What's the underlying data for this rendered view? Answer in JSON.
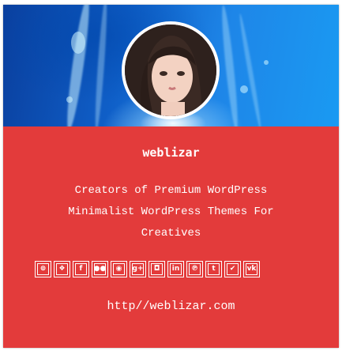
{
  "profile": {
    "name": "weblizar",
    "description_lines": [
      "Creators of Premium WordPress",
      "Minimalist WordPress Themes For",
      "Creatives"
    ],
    "url": "http//weblizar.com"
  },
  "social_icons": [
    {
      "name": "instagram-icon",
      "glyph": "⊚"
    },
    {
      "name": "dropbox-icon",
      "glyph": "❖"
    },
    {
      "name": "facebook-icon",
      "glyph": "f"
    },
    {
      "name": "flickr-icon",
      "glyph": "●●"
    },
    {
      "name": "github-icon",
      "glyph": "◉"
    },
    {
      "name": "google-plus-icon",
      "glyph": "g+"
    },
    {
      "name": "camera-icon",
      "glyph": "◘"
    },
    {
      "name": "linkedin-icon",
      "glyph": "in"
    },
    {
      "name": "pinterest-icon",
      "glyph": "℗"
    },
    {
      "name": "tumblr-icon",
      "glyph": "t"
    },
    {
      "name": "twitter-icon",
      "glyph": "✔"
    },
    {
      "name": "vk-icon",
      "glyph": "vk"
    }
  ],
  "colors": {
    "card_background": "#e33b3b",
    "banner_blue": "#1a86e8",
    "text": "#ffffff"
  }
}
